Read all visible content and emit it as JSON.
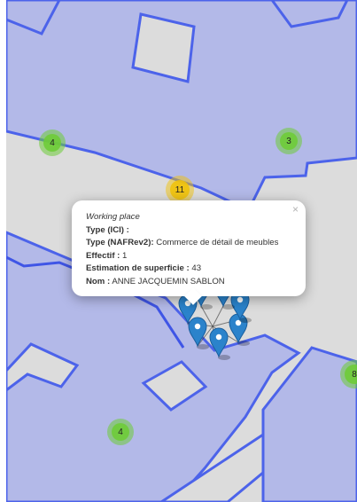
{
  "map": {
    "clusters": [
      {
        "id": "cluster-4-top-left",
        "label": "4",
        "color": "green"
      },
      {
        "id": "cluster-3-right",
        "label": "3",
        "color": "green"
      },
      {
        "id": "cluster-11-center",
        "label": "11",
        "color": "yellow"
      },
      {
        "id": "cluster-8-edge",
        "label": "8",
        "color": "green"
      },
      {
        "id": "cluster-4-bottom",
        "label": "4",
        "color": "green"
      }
    ],
    "marker_count": 7,
    "colors": {
      "background": "#dcdcdc",
      "parcel_fill": "#b3b9e8",
      "parcel_stroke": "#4c63ea",
      "marker": "#2b83cb"
    }
  },
  "popup": {
    "title": "Working place",
    "close_symbol": "×",
    "fields": [
      {
        "label": "Type (ICI) :",
        "value": ""
      },
      {
        "label": "Type (NAFRev2):",
        "value": " Commerce de détail de meubles"
      },
      {
        "label": "Effectif :",
        "value": " 1"
      },
      {
        "label": "Estimation de superficie :",
        "value": " 43"
      },
      {
        "label": "Nom :",
        "value": " ANNE JACQUEMIN SABLON"
      }
    ]
  }
}
